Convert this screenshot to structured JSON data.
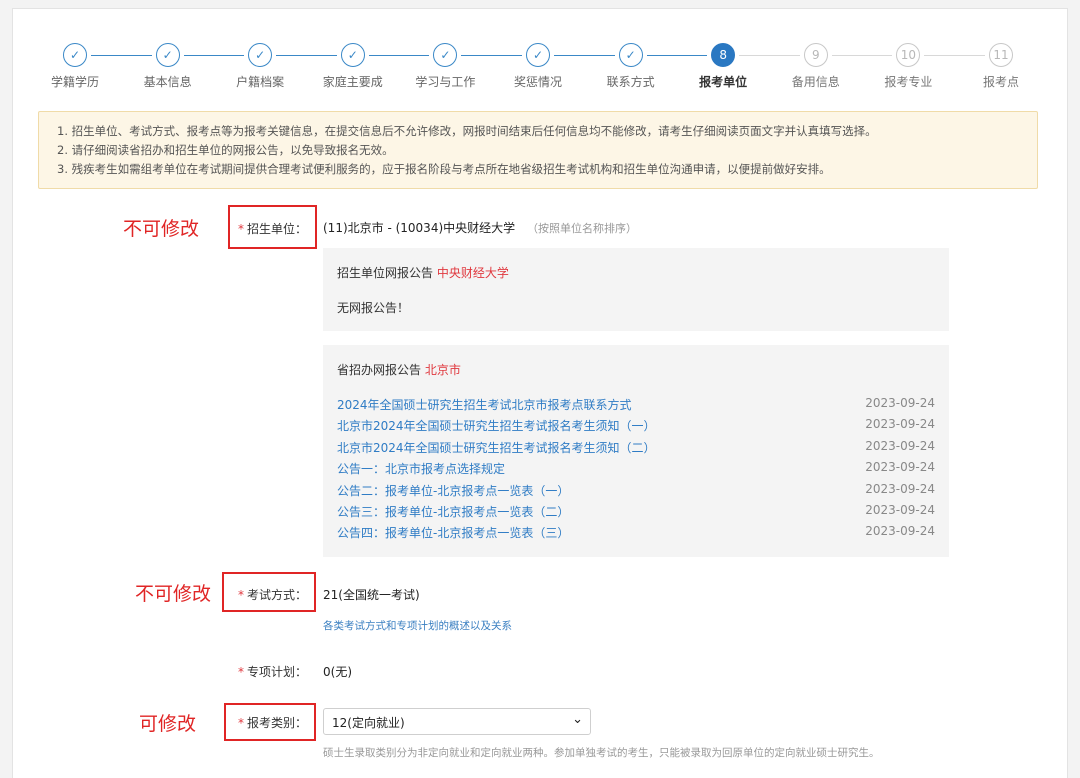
{
  "steps": [
    {
      "num": "1",
      "label": "学籍学历",
      "state": "done"
    },
    {
      "num": "2",
      "label": "基本信息",
      "state": "done"
    },
    {
      "num": "3",
      "label": "户籍档案",
      "state": "done"
    },
    {
      "num": "4",
      "label": "家庭主要成",
      "state": "done"
    },
    {
      "num": "5",
      "label": "学习与工作",
      "state": "done"
    },
    {
      "num": "6",
      "label": "奖惩情况",
      "state": "done"
    },
    {
      "num": "7",
      "label": "联系方式",
      "state": "done"
    },
    {
      "num": "8",
      "label": "报考单位",
      "state": "active"
    },
    {
      "num": "9",
      "label": "备用信息",
      "state": "todo"
    },
    {
      "num": "10",
      "label": "报考专业",
      "state": "todo"
    },
    {
      "num": "11",
      "label": "报考点",
      "state": "todo"
    }
  ],
  "check_glyph": "✓",
  "notice": [
    "1. 招生单位、考试方式、报考点等为报考关键信息，在提交信息后不允许修改，网报时间结束后任何信息均不能修改，请考生仔细阅读页面文字并认真填写选择。",
    "2. 请仔细阅读省招办和招生单位的网报公告，以免导致报名无效。",
    "3. 残疾考生如需组考单位在考试期间提供合理考试便利服务的，应于报名阶段与考点所在地省级招生考试机构和招生单位沟通申请，以便提前做好安排。"
  ],
  "annotations": {
    "unit_note": "不可修改",
    "exam_note": "不可修改",
    "category_note": "可修改"
  },
  "fields": {
    "required_mark": "*",
    "unit_label": "招生单位：",
    "unit_value": "(11)北京市 - (10034)中央财经大学",
    "unit_hint": "（按照单位名称排序）",
    "exam_label": "考试方式：",
    "exam_value": "21(全国统一考试)",
    "exam_link": "各类考试方式和专项计划的概述以及关系",
    "special_label": "专项计划：",
    "special_value": "0(无)",
    "category_label": "报考类别：",
    "category_value": "12(定向就业)",
    "category_hint": "硕士生录取类别分为非定向就业和定向就业两种。参加单独考试的考生，只能被录取为回原单位的定向就业硕士研究生。"
  },
  "school_announce": {
    "title": "招生单位网报公告",
    "school": "中央财经大学",
    "empty": "无网报公告！"
  },
  "province_announce": {
    "title": "省招办网报公告",
    "province": "北京市",
    "items": [
      {
        "title": "2024年全国硕士研究生招生考试北京市报考点联系方式",
        "date": "2023-09-24"
      },
      {
        "title": "北京市2024年全国硕士研究生招生考试报名考生须知（一）",
        "date": "2023-09-24"
      },
      {
        "title": "北京市2024年全国硕士研究生招生考试报名考生须知（二）",
        "date": "2023-09-24"
      },
      {
        "title": "公告一：北京市报考点选择规定",
        "date": "2023-09-24"
      },
      {
        "title": "公告二：报考单位-北京报考点一览表（一）",
        "date": "2023-09-24"
      },
      {
        "title": "公告三：报考单位-北京报考点一览表（二）",
        "date": "2023-09-24"
      },
      {
        "title": "公告四：报考单位-北京报考点一览表（三）",
        "date": "2023-09-24"
      }
    ]
  },
  "icons": {
    "select_chevron": "chevron-down-icon",
    "step_done": "check-icon"
  },
  "colors": {
    "primary": "#2a78c2",
    "required": "#e0383e",
    "annotation": "#e02525",
    "notice_bg": "#fdf6e6",
    "link": "#2f7cc5"
  }
}
